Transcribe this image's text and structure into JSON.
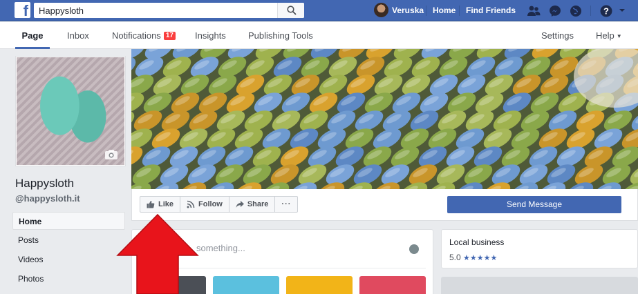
{
  "topbar": {
    "search_value": "Happysloth",
    "user_name": "Veruska",
    "home_label": "Home",
    "find_friends_label": "Find Friends"
  },
  "pagenav": {
    "items": [
      {
        "label": "Page",
        "active": true
      },
      {
        "label": "Inbox"
      },
      {
        "label": "Notifications",
        "badge": "17"
      },
      {
        "label": "Insights"
      },
      {
        "label": "Publishing Tools"
      }
    ],
    "settings_label": "Settings",
    "help_label": "Help"
  },
  "profile": {
    "name": "Happysloth",
    "handle": "@happysloth.it"
  },
  "left_nav": [
    {
      "label": "Home",
      "active": true
    },
    {
      "label": "Posts"
    },
    {
      "label": "Videos"
    },
    {
      "label": "Photos"
    }
  ],
  "actions": {
    "like_label": "Like",
    "follow_label": "Follow",
    "share_label": "Share",
    "more_label": "···",
    "send_message_label": "Send Message"
  },
  "composer": {
    "placeholder": "something..."
  },
  "info": {
    "category": "Local business",
    "rating": "5.0",
    "stars": "★★★★★"
  },
  "colors": {
    "brand_blue": "#4267b2",
    "badge_red": "#fa3e3e",
    "arrow_red": "#e8141b"
  }
}
